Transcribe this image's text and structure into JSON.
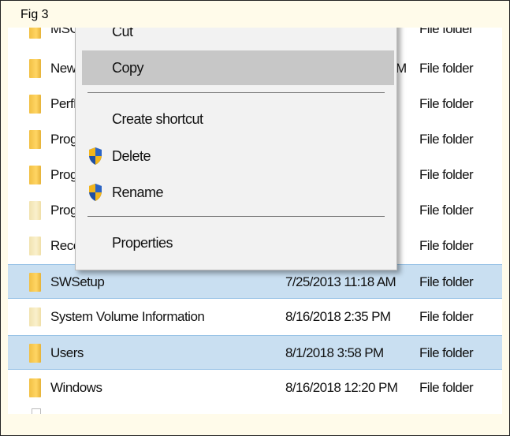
{
  "caption": "Fig 3",
  "context_menu": {
    "items": [
      {
        "label": "Cut",
        "icon": ""
      },
      {
        "label": "Copy",
        "icon": ""
      },
      {
        "label": "Create shortcut",
        "icon": ""
      },
      {
        "label": "Delete",
        "icon": "uac-shield-icon"
      },
      {
        "label": "Rename",
        "icon": "uac-shield-icon"
      },
      {
        "label": "Properties",
        "icon": ""
      }
    ]
  },
  "files": [
    {
      "name": "MSO",
      "date": "",
      "type": "File folder",
      "selected": false,
      "style": "full"
    },
    {
      "name": "New",
      "date": "M",
      "type": "File folder",
      "selected": false,
      "style": "full"
    },
    {
      "name": "PerfL",
      "date": "",
      "type": "File folder",
      "selected": false,
      "style": "full"
    },
    {
      "name": "Prog",
      "date": "",
      "type": "File folder",
      "selected": false,
      "style": "full"
    },
    {
      "name": "Prog",
      "date": "",
      "type": "File folder",
      "selected": false,
      "style": "full"
    },
    {
      "name": "Prog",
      "date": "",
      "type": "File folder",
      "selected": false,
      "style": "pale"
    },
    {
      "name": "Reco",
      "date": "",
      "type": "File folder",
      "selected": false,
      "style": "pale"
    },
    {
      "name": "SWSetup",
      "date": "7/25/2013 11:18 AM",
      "type": "File folder",
      "selected": true,
      "style": "full"
    },
    {
      "name": "System Volume Information",
      "date": "8/16/2018 2:35 PM",
      "type": "File folder",
      "selected": false,
      "style": "pale"
    },
    {
      "name": "Users",
      "date": "8/1/2018 3:58 PM",
      "type": "File folder",
      "selected": true,
      "style": "full"
    },
    {
      "name": "Windows",
      "date": "8/16/2018 12:20 PM",
      "type": "File folder",
      "selected": false,
      "style": "full"
    }
  ],
  "colors": {
    "selection": "#c9dff1",
    "menu_background": "#f2f2f2",
    "menu_hover": "#c7c7c7",
    "caption_background": "#fffbea",
    "folder_yellow": "#ffd564"
  }
}
